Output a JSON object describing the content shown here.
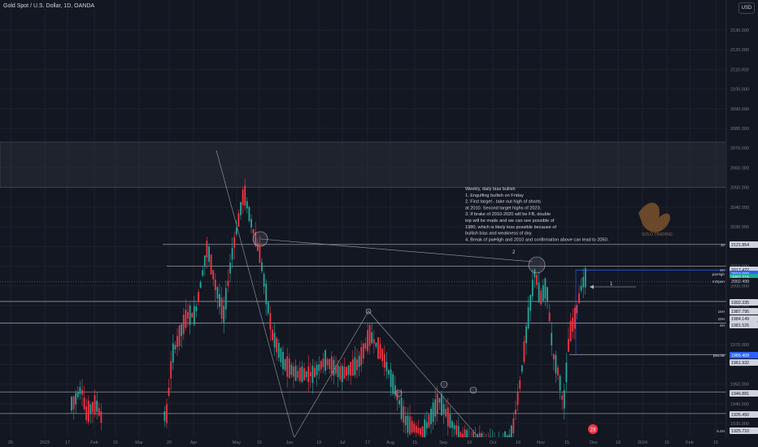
{
  "header": {
    "title": "Gold Spot / U.S. Dollar, 1D, OANDA",
    "currency_button": "USD"
  },
  "annotation": {
    "lines": [
      "Weekly, daily bias bullish",
      "1. Engulfing bullish on Friday",
      "2. First target - take out high of shorts",
      "at 2010. Second target highs of 2023.",
      "3. If brake of 2010-2020 will be FB, double",
      "top will be made and we can see possible of",
      "1980, which is likely less possible because of",
      "bullish bias and weakness of dxy.",
      "4. Break of pwHigh and 2010 and confirmation above can lead to 2050."
    ],
    "marker_1": "1",
    "marker_2": "2"
  },
  "logo_text": "SOLO TRADING",
  "event_badge": "23",
  "colors": {
    "background": "#131722",
    "bull": "#26a69a",
    "bear": "#f23645",
    "grid": "#1e222d",
    "text": "#d1d4dc",
    "zone": "#2a2e39",
    "level_line": "#b2b5be",
    "pwhigh_line": "#2962ff",
    "current_price_badge": "#26a69a",
    "blue_badge": "#2962ff"
  },
  "chart_data": {
    "type": "candlestick",
    "title": "Gold Spot / U.S. Dollar, 1D, OANDA",
    "y_axis_ticks": [
      2130,
      2120,
      2110,
      2100,
      2090,
      2080,
      2070,
      2060,
      2050,
      2040,
      2030,
      2020,
      2010,
      2000,
      1990,
      1980,
      1970,
      1960,
      1950,
      1940,
      1930
    ],
    "ylim": [
      1923,
      2145
    ],
    "x_axis_labels": [
      "25",
      "2023",
      "17",
      "Feb",
      "15",
      "Mar",
      "20",
      "Apr",
      "May",
      "15",
      "Jun",
      "19",
      "Jul",
      "17",
      "Aug",
      "15",
      "Sep",
      "18",
      "Oct",
      "16",
      "Nov",
      "15",
      "Dec",
      "18",
      "2024",
      "15",
      "Feb",
      "15"
    ],
    "price_labels": [
      {
        "value": "2121.854",
        "label": "10"
      },
      {
        "value": "2017.422",
        "label": "4H"
      },
      {
        "value": "2010.000",
        "label": "pwHigh"
      },
      {
        "value": "2002.715",
        "label": ""
      },
      {
        "value": "2002.499",
        "label": "mOpen"
      },
      {
        "value": "1992.335",
        "label": ""
      },
      {
        "value": "1987.795",
        "label": "15H"
      },
      {
        "value": "1984.149",
        "label": "15H"
      },
      {
        "value": "1981.525",
        "label": "4H"
      },
      {
        "value": "1965.409",
        "label": "pwLow"
      },
      {
        "value": "1961.932",
        "label": ""
      },
      {
        "value": "1946.881",
        "label": ""
      },
      {
        "value": "1935.450",
        "label": ""
      },
      {
        "value": "1925.710",
        "label": "5.4H"
      }
    ],
    "zone": {
      "top": 2073,
      "bottom": 2050
    },
    "horizontal_levels": [
      2021,
      2010,
      1992,
      1981,
      1965,
      1946,
      1935
    ],
    "trend_lines": [
      {
        "from": [
          "Apr 28",
          2068
        ],
        "to": [
          "Jun 15",
          1923
        ]
      },
      {
        "from": [
          "Jun 20",
          1923
        ],
        "to": [
          "Jul 28",
          1983
        ]
      },
      {
        "from": [
          "Jul 28",
          1983
        ],
        "to": [
          "Sep 10",
          1943
        ]
      }
    ],
    "candles_summary": "Daily OHLC from late Dec 2022 to Nov 2023; rally to ~2050 in early May, decline to ~1925 by early Oct, spike to ~2010 late Oct, pullback to ~1932 mid Nov, then rally to ~2003 late Nov."
  }
}
